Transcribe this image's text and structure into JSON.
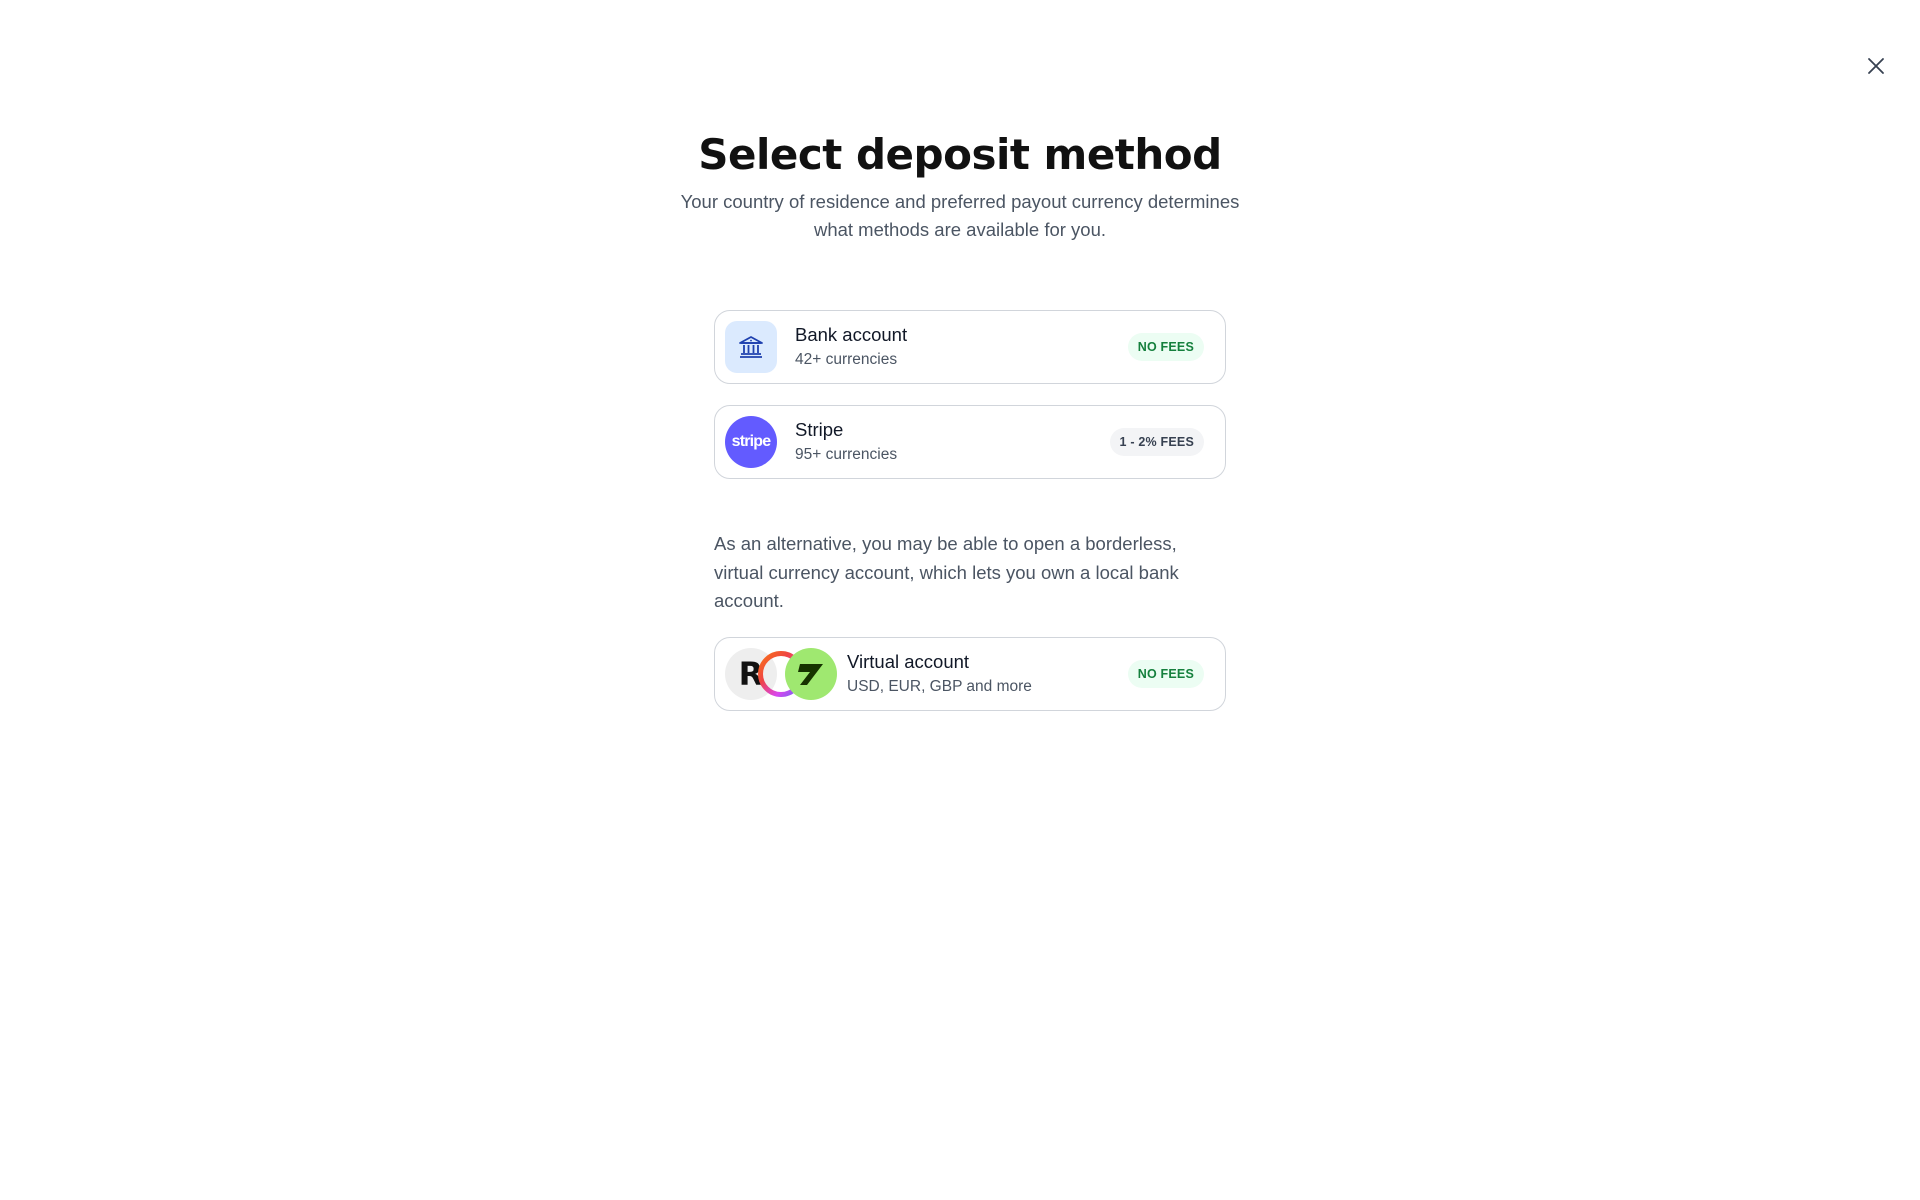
{
  "header": {
    "title": "Select deposit method",
    "subtitle": "Your country of residence and preferred payout currency determines what methods are available for you.",
    "close_icon": "close-icon"
  },
  "methods": [
    {
      "id": "bank",
      "icon": "bank-icon",
      "title": "Bank account",
      "subtitle": "42+ currencies",
      "badge": "NO FEES",
      "badge_color": "#15803d"
    },
    {
      "id": "stripe",
      "icon": "stripe-logo",
      "icon_text": "stripe",
      "title": "Stripe",
      "subtitle": "95+ currencies",
      "badge": "1 - 2% FEES",
      "badge_color": "#374151"
    }
  ],
  "alternative": {
    "text": "As an alternative, you may be able to open a borderless, virtual currency account, which lets you own a local bank account."
  },
  "virtual": {
    "icons": [
      "revolut-logo",
      "ring-logo",
      "wise-logo"
    ],
    "revolut_letter": "R",
    "title": "Virtual account",
    "subtitle": "USD, EUR, GBP and more",
    "badge": "NO FEES",
    "badge_color": "#15803d"
  },
  "colors": {
    "stripe": "#635bff",
    "bank_icon_bg": "#dbeafe",
    "wise": "#9fe870",
    "green_badge_bg": "#ecfdf3"
  }
}
